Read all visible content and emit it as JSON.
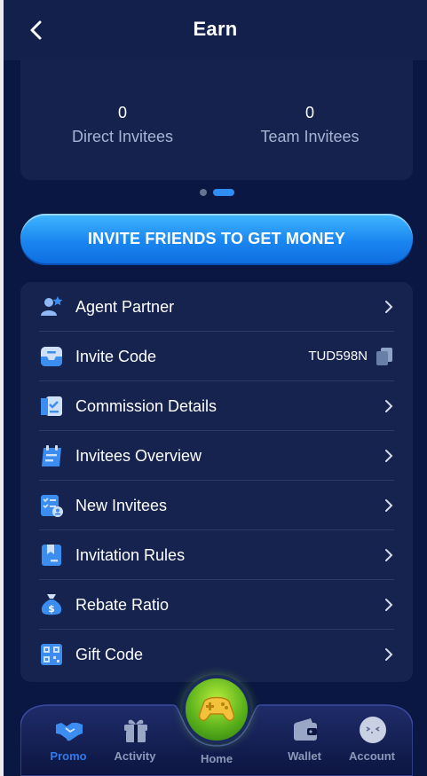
{
  "header": {
    "title": "Earn"
  },
  "stats": {
    "direct": {
      "value": "0",
      "label": "Direct Invitees"
    },
    "team": {
      "value": "0",
      "label": "Team Invitees"
    }
  },
  "carousel": {
    "active_index": 1,
    "count": 2
  },
  "invite_button": {
    "label": "INVITE FRIENDS TO GET MONEY"
  },
  "menu": {
    "items": [
      {
        "label": "Agent Partner",
        "icon": "agent-partner-icon"
      },
      {
        "label": "Invite Code",
        "icon": "invite-code-icon",
        "value": "TUD598N"
      },
      {
        "label": "Commission Details",
        "icon": "commission-icon"
      },
      {
        "label": "Invitees Overview",
        "icon": "overview-icon"
      },
      {
        "label": "New Invitees",
        "icon": "new-invitees-icon"
      },
      {
        "label": "Invitation Rules",
        "icon": "rules-icon"
      },
      {
        "label": "Rebate Ratio",
        "icon": "money-bag-icon"
      },
      {
        "label": "Gift Code",
        "icon": "qr-code-icon"
      }
    ]
  },
  "tabbar": {
    "tabs": [
      {
        "label": "Promo",
        "icon": "handshake-icon",
        "active": true
      },
      {
        "label": "Activity",
        "icon": "gift-icon",
        "active": false
      },
      {
        "label": "Home",
        "icon": "gamepad-icon",
        "active": false
      },
      {
        "label": "Wallet",
        "icon": "wallet-icon",
        "active": false
      },
      {
        "label": "Account",
        "icon": "avatar-icon",
        "active": false
      }
    ]
  },
  "colors": {
    "accent": "#2f8ef3",
    "background": "#0a1742",
    "card": "#16234f",
    "active_tab": "#2f7bea"
  }
}
